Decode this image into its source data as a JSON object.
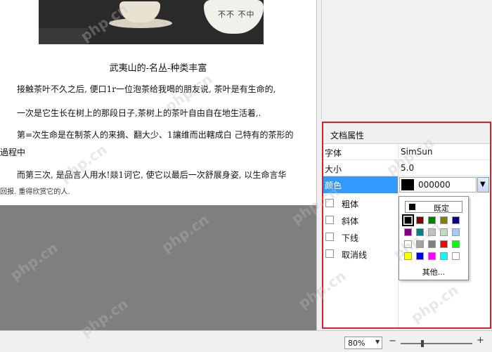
{
  "document": {
    "photo_text": "不不 不中",
    "title": "武夷山的-名丛-种类丰富",
    "paragraphs": [
      "接触茶叶不久之后, 便口1r一位泡茶给我喝的朋友说, 茶叶是有生命的,",
      "一次是它生长在树上的那段日子,茶树上的茶叶自由自在地生活着,.",
      "第=次生命是在制茶人的来摘、翻大少、1讓维而出轄成白  己特有的茶形的",
      "過程中",
      "而第三次, 是品言人用水!燚1诃它, 使它以最后一次舒展身姿, 以生命言华",
      "回报.  重得欣赏它的人."
    ]
  },
  "properties_panel": {
    "title": "文档属性",
    "rows": [
      {
        "key": "字体",
        "value": "SimSun"
      },
      {
        "key": "大小",
        "value": "5.0"
      },
      {
        "key": "颜色",
        "value": "000000"
      }
    ],
    "checkboxes": [
      {
        "label": "粗体",
        "checked": false
      },
      {
        "label": "斜体",
        "checked": false
      },
      {
        "label": "下线",
        "checked": false
      },
      {
        "label": "取消线",
        "checked": false
      }
    ],
    "dropdown_icon": "chevron-down-icon"
  },
  "color_picker": {
    "default_label": "既定",
    "more_label": "其他...",
    "selected": "#000000",
    "swatches": [
      [
        "#000000",
        "#800000",
        "#008000",
        "#808000",
        "#000080"
      ],
      [
        "#800080",
        "#008080",
        "#c0c0c0",
        "#c0dcc0",
        "#a6caf0"
      ],
      [
        "#fffbf0",
        "#a0a0a4",
        "#808080",
        "#ff0000",
        "#00ff00"
      ],
      [
        "#ffff00",
        "#0000ff",
        "#ff00ff",
        "#00ffff",
        "#ffffff"
      ]
    ]
  },
  "status_bar": {
    "zoom": "80%",
    "zoom_out": "−",
    "zoom_in": "+",
    "zoom_level_fraction": 0.3
  },
  "watermark": "php.cn"
}
